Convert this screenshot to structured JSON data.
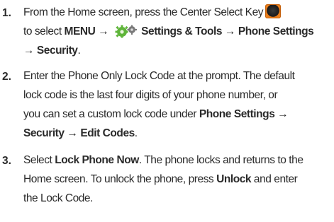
{
  "steps": [
    {
      "num": "1.",
      "l1a": "From the Home screen, press the Center Select Key",
      "l2a": "to select ",
      "l2b": "MENU → ",
      "l2c": "Settings & Tools → Phone Settings",
      "l3": "→ Security",
      "l3end": "."
    },
    {
      "num": "2.",
      "l1": "Enter the Phone Only Lock Code at the prompt. The default",
      "l2": "lock code is the last four digits of your phone number, or",
      "l3a": "you can set a custom lock code under ",
      "l3b": "Phone Settings →",
      "l4a": "Security → Edit Codes",
      "l4b": "."
    },
    {
      "num": "3.",
      "l1a": "Select ",
      "l1b": "Lock Phone Now",
      "l1c": ". The phone locks and returns to the",
      "l2a": "Home screen. To unlock the phone, press ",
      "l2b": "Unlock",
      "l2c": " and enter",
      "l3": "the Lock Code."
    }
  ],
  "icons": {
    "center_key": "center-select-key-icon",
    "settings": "settings-tools-icon"
  },
  "colors": {
    "text": "#2a2a2a",
    "key_accent": "#f08a20",
    "gear_green": "#5fb53a"
  }
}
